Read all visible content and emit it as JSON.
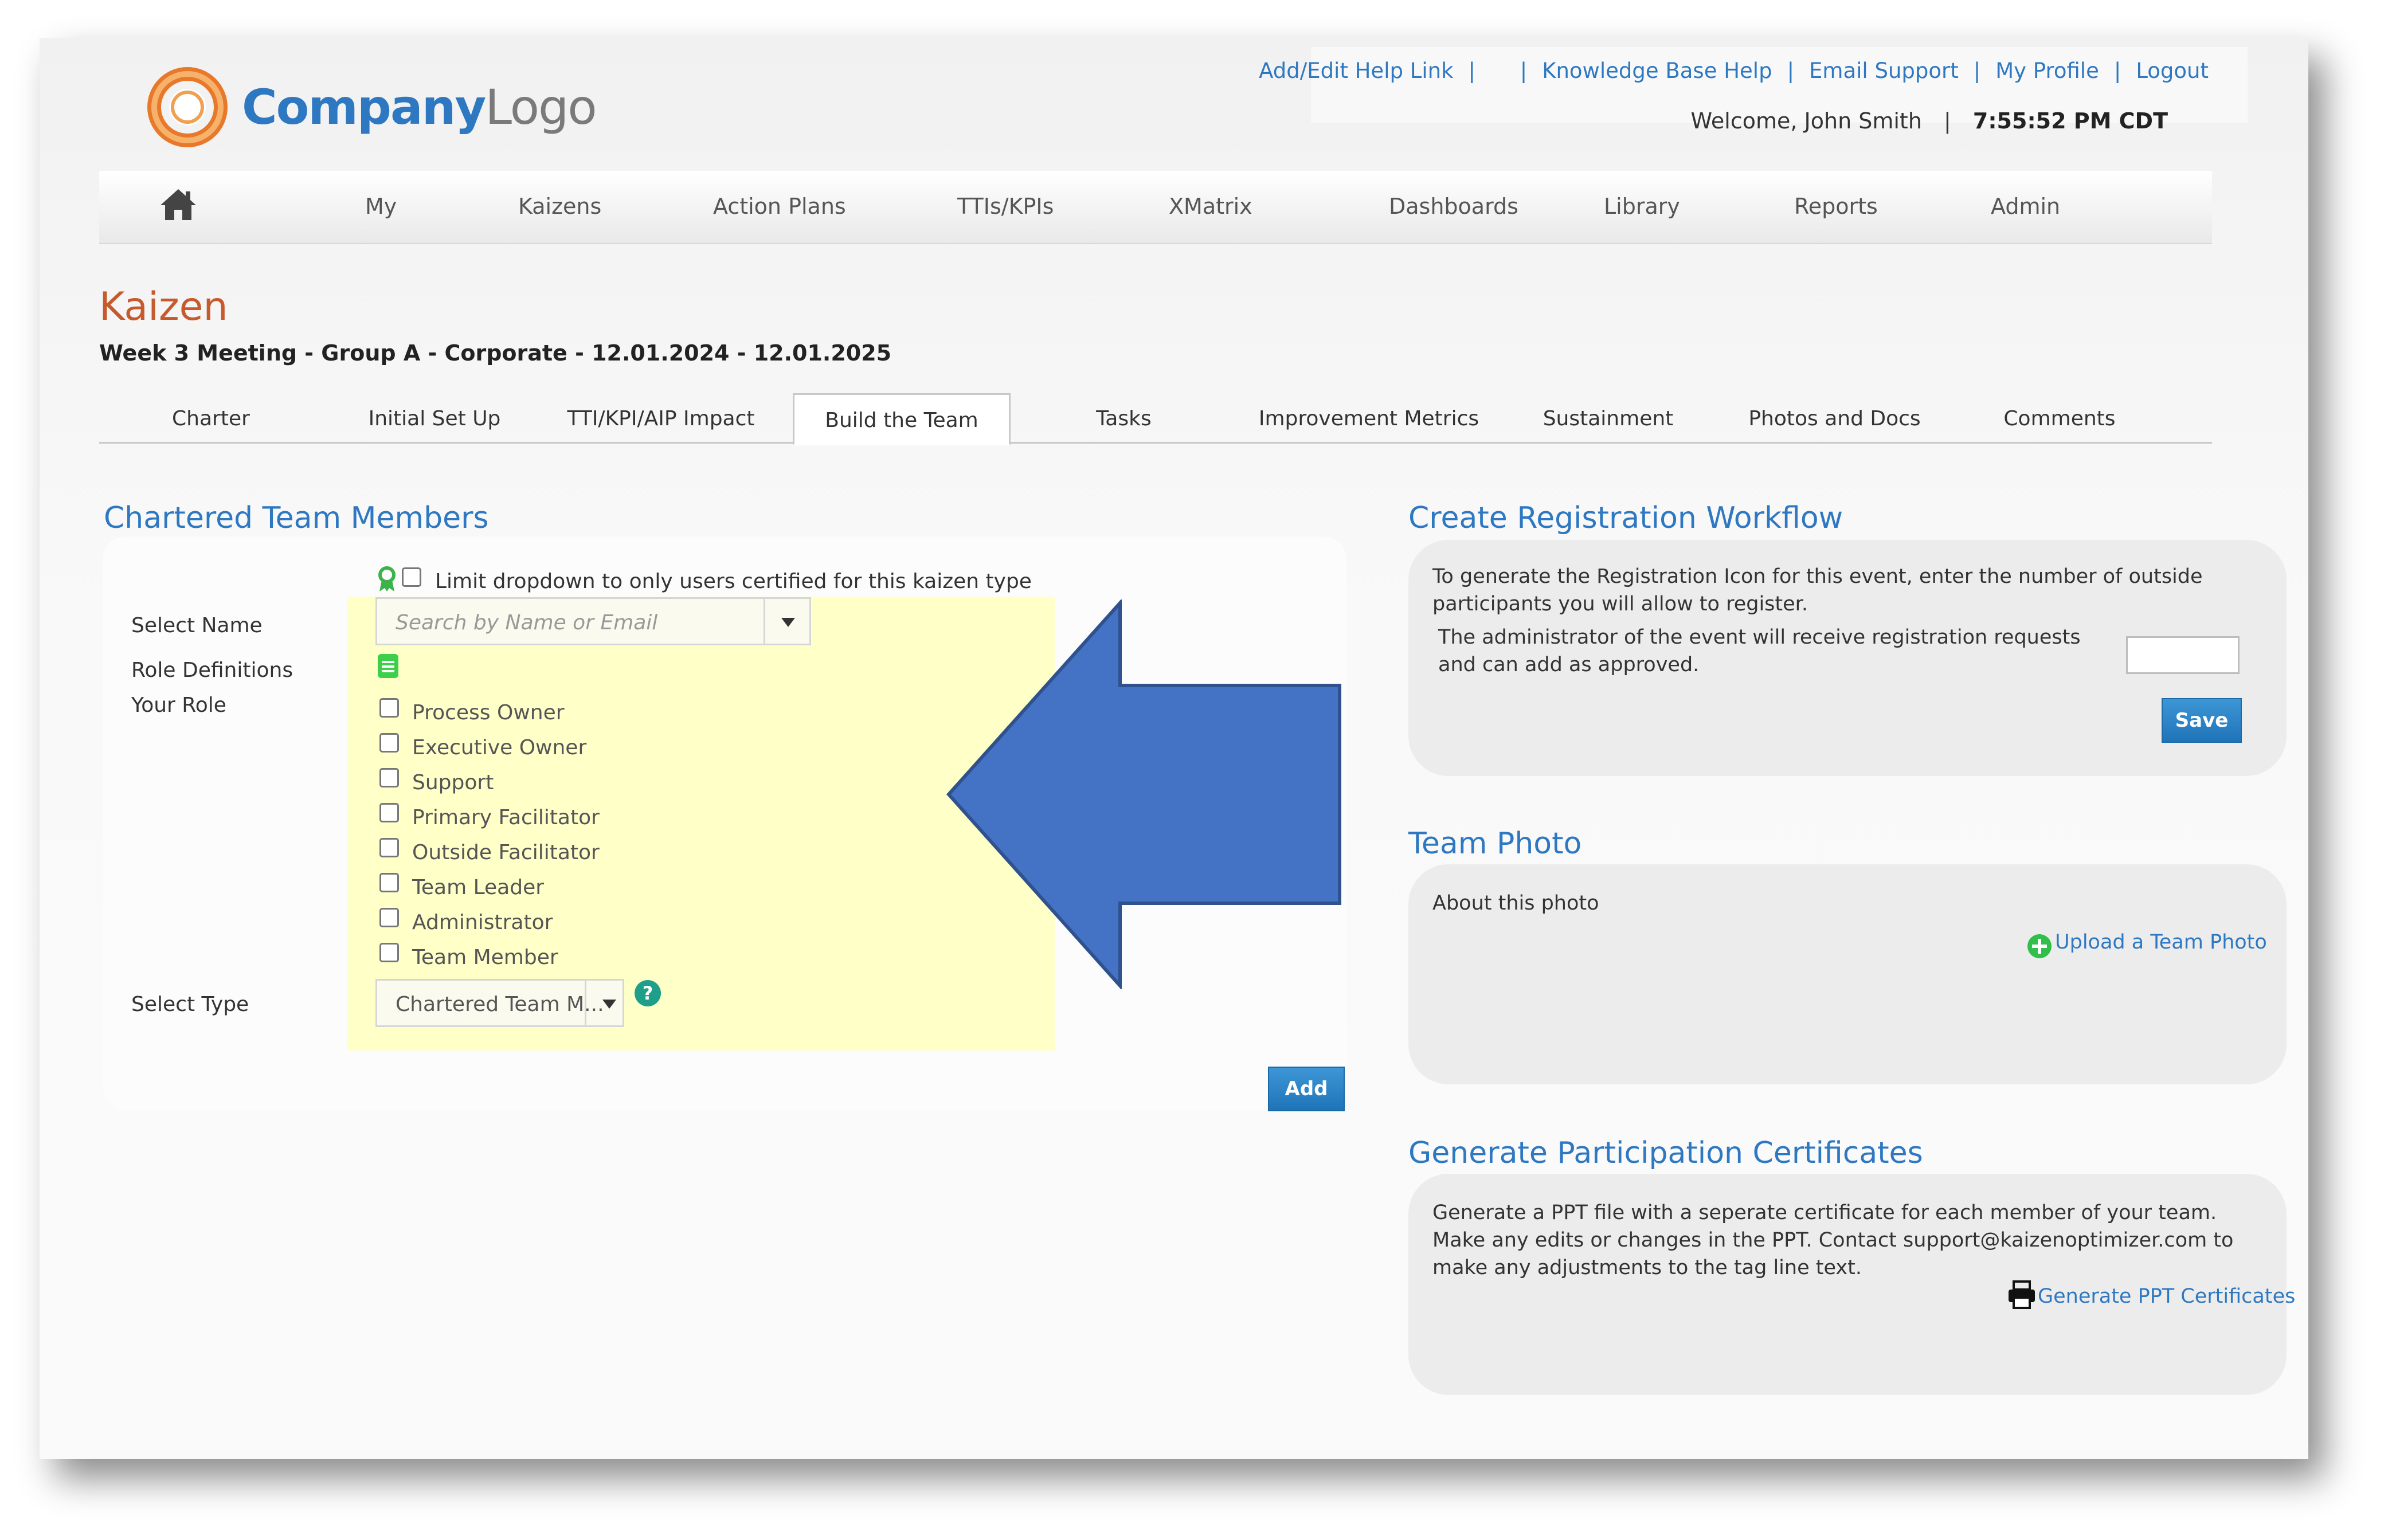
{
  "header": {
    "logo_text_a": "Company",
    "logo_text_b": "Logo",
    "links": [
      "Add/Edit Help Link",
      "Knowledge Base Help",
      "Email Support",
      "My Profile",
      "Logout"
    ],
    "welcome": "Welcome, John Smith",
    "time": "7:55:52 PM CDT"
  },
  "nav": {
    "items": [
      "My",
      "Kaizens",
      "Action Plans",
      "TTIs/KPIs",
      "XMatrix",
      "Dashboards",
      "Library",
      "Reports",
      "Admin"
    ]
  },
  "page": {
    "title": "Kaizen",
    "subtitle": "Week 3 Meeting - Group A - Corporate - 12.01.2024 - 12.01.2025"
  },
  "tabs": [
    "Charter",
    "Initial Set Up",
    "TTI/KPI/AIP Impact",
    "Build the Team",
    "Tasks",
    "Improvement Metrics",
    "Sustainment",
    "Photos and Docs",
    "Comments"
  ],
  "active_tab": "Build the Team",
  "team": {
    "section_title": "Chartered Team Members",
    "limit_label": "Limit dropdown to only users certified for this kaizen type",
    "select_name_label": "Select Name",
    "search_placeholder": "Search by Name or Email",
    "role_definitions_label": "Role Definitions",
    "your_role_label": "Your Role",
    "roles": [
      "Process Owner",
      "Executive Owner",
      "Support",
      "Primary Facilitator",
      "Outside Facilitator",
      "Team Leader",
      "Administrator",
      "Team Member"
    ],
    "select_type_label": "Select Type",
    "select_type_value": "Chartered Team M...",
    "add_button": "Add"
  },
  "registration": {
    "title": "Create Registration Workflow",
    "text1": "To generate the Registration Icon for this event, enter the number of outside participants you will allow to register.",
    "text2": "The administrator of the event will receive registration requests and can add as approved.",
    "input_value": "",
    "save_button": "Save"
  },
  "photo": {
    "title": "Team Photo",
    "about": "About this photo",
    "upload_link": "Upload a Team Photo"
  },
  "certificates": {
    "title": "Generate Participation Certificates",
    "text": "Generate a PPT file with a seperate certificate for each member of your team. Make any edits or changes in the PPT. Contact support@kaizenoptimizer.com to make any adjustments to the tag line text.",
    "link": "Generate PPT Certificates"
  },
  "colors": {
    "accent": "#2e78c2",
    "title": "#c65a2c",
    "highlight": "#ffffc8",
    "arrow": "#4472c4"
  }
}
